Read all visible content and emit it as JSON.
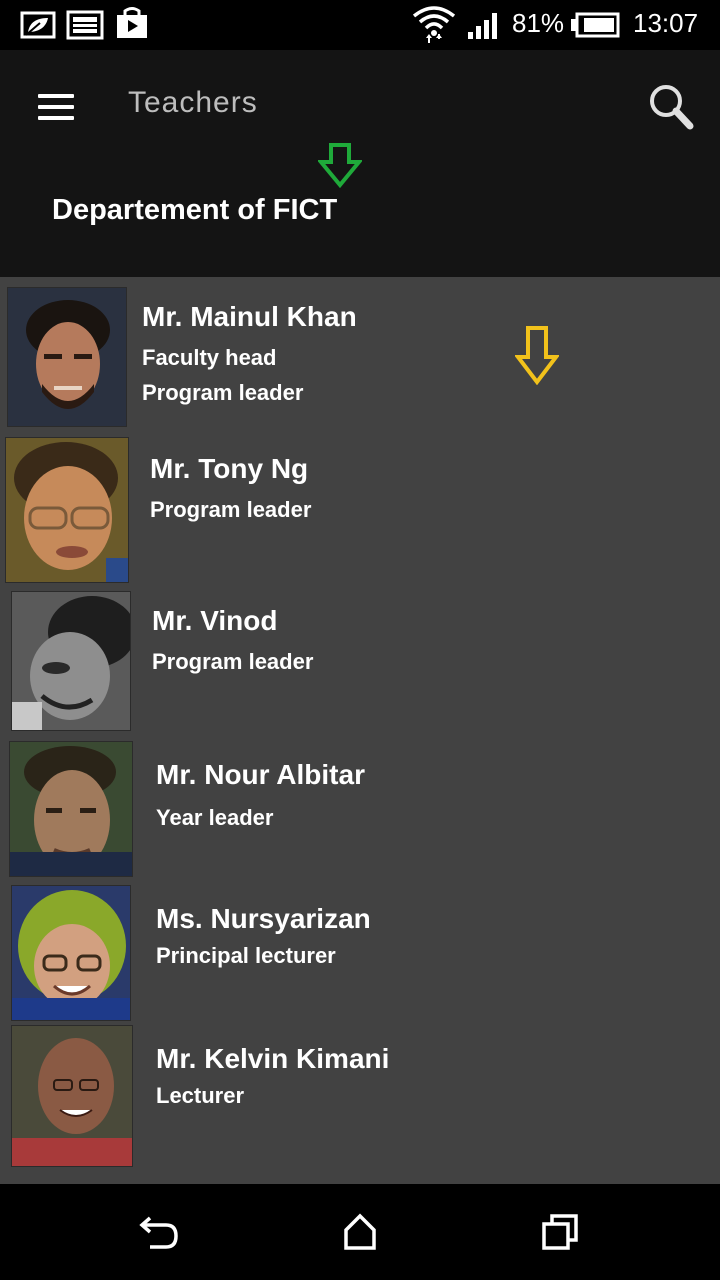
{
  "status_bar": {
    "battery": "81%",
    "time": "13:07",
    "icons": [
      "leaf-notification-icon",
      "image-notification-icon",
      "shopping-bag-icon",
      "wifi-icon",
      "signal-icon",
      "battery-icon"
    ]
  },
  "header": {
    "title": "Teachers",
    "department": "Departement of FICT",
    "menu_icon": "hamburger-menu-icon",
    "search_icon": "search-icon"
  },
  "teachers": [
    {
      "name": "Mr. Mainul Khan",
      "roles": [
        "Faculty head",
        "Program leader"
      ]
    },
    {
      "name": "Mr. Tony Ng",
      "roles": [
        "Program leader"
      ]
    },
    {
      "name": "Mr. Vinod",
      "roles": [
        "Program leader"
      ]
    },
    {
      "name": "Mr. Nour Albitar",
      "roles": [
        "Year leader"
      ]
    },
    {
      "name": "Ms. Nursyarizan",
      "roles": [
        "Principal lecturer"
      ]
    },
    {
      "name": "Mr. Kelvin Kimani",
      "roles": [
        "Lecturer"
      ]
    }
  ],
  "nav_bar": {
    "icons": [
      "back-icon",
      "home-icon",
      "recent-apps-icon"
    ]
  },
  "colors": {
    "header_bg": "#141414",
    "list_bg": "#424242",
    "green_arrow": "#1faa3a",
    "yellow_arrow": "#f2c21b"
  }
}
